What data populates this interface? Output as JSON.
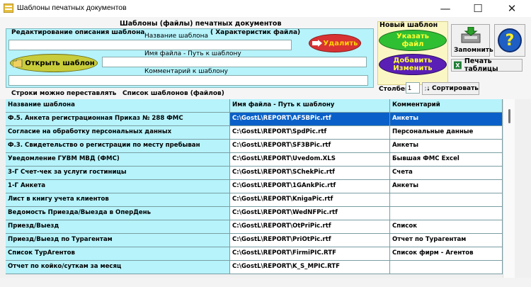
{
  "window": {
    "title": "Шаблоны печатных документов",
    "min": "—",
    "max": "☐",
    "close": "✕"
  },
  "group": {
    "title": "Шаблоны (файлы) печатных документов",
    "edit_label": "Редактирование описания шаблона",
    "chars_label": "( Характеристик файла)",
    "name_label": "Название шаблона",
    "name_value": "",
    "file_label": "Имя файла - Путь к шаблону",
    "file_value": "",
    "comment_label": "Комментарий к шаблону",
    "comment_value": "",
    "delete_label": "Удалить",
    "open_label": "Открыть шаблон"
  },
  "new_template": {
    "title": "Новый шаблон",
    "specify_line1": "Указать",
    "specify_line2": "файл",
    "addedit_line1": "Добавить",
    "addedit_line2": "Изменить"
  },
  "toolbar": {
    "remember_label": "Запомнить",
    "help_label": "?",
    "print_label": "Печать таблицы",
    "column_label": "Столбец",
    "column_value": "1",
    "sort_label": "Сортировать",
    "rows_hint": "Строки можно переставлять",
    "list_title": "Список шаблонов (файлов)"
  },
  "table": {
    "headers": [
      "Название шаблона",
      "Имя файла - Путь к шаблону",
      "Комментарий"
    ],
    "selected_row": 0,
    "rows": [
      [
        "Ф.5. Анкета регистрационная Приказ № 288 ФМС",
        "C:\\GostL\\REPORT\\AF5BPic.rtf",
        "Анкеты"
      ],
      [
        "Согласие на обработку персональных данных",
        "C:\\GostL\\REPORT\\SpdPic.rtf",
        "Персональные данные"
      ],
      [
        "Ф.3. Свидетельство о регистрации по месту пребыван",
        "C:\\GostL\\REPORT\\SF3BPic.rtf",
        "Анкеты"
      ],
      [
        "Уведомление ГУВМ МВД (ФМС)",
        "C:\\GostL\\REPORT\\Uvedom.XLS",
        "Бывшая ФМС Excel"
      ],
      [
        "3-Г Счет-чек за услуги гостиницы",
        "C:\\GostL\\REPORT\\SChekPic.rtf",
        "Счета"
      ],
      [
        "1-Г Анкета",
        "C:\\GostL\\REPORT\\1GAnkPic.rtf",
        "Анкеты"
      ],
      [
        "Лист в книгу учета клиентов",
        "C:\\GostL\\REPORT\\KnigaPic.rtf",
        ""
      ],
      [
        "Ведомость Приезда/Выезда в ОперДень",
        "C:\\GostL\\REPORT\\WedNFPic.rtf",
        ""
      ],
      [
        "Приезд/Выезд",
        "C:\\GostL\\REPORT\\OtPriPic.rtf",
        "Список"
      ],
      [
        "Приезд/Выезд по Турагентам",
        "C:\\GostL\\REPORT\\PriOtPic.rtf",
        "Отчет по Турагентам"
      ],
      [
        "Список ТурАгентов",
        "C:\\GostL\\REPORT\\FirmiPIC.RTF",
        "Список фирм - Агентов"
      ],
      [
        "Отчет по койко/суткам за месяц",
        "C:\\GostL\\REPORT\\K_S_MPIC.RTF",
        ""
      ]
    ]
  }
}
